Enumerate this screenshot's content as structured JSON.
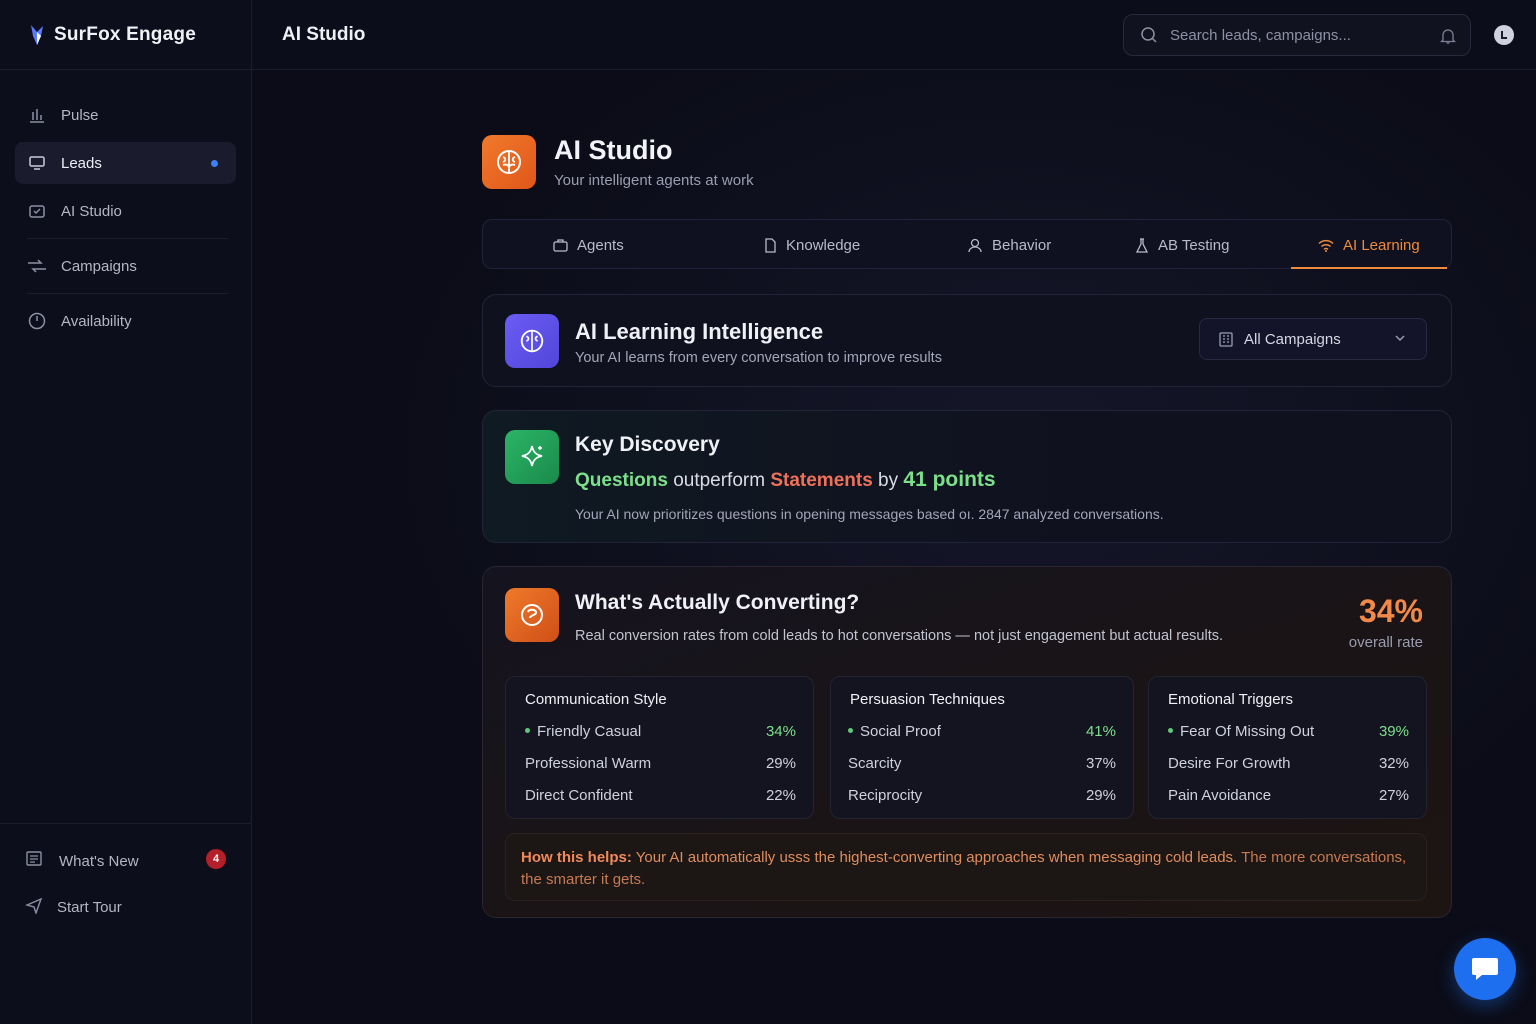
{
  "brand": {
    "name": "SurFox Engage"
  },
  "topbar": {
    "title": "AI Studio",
    "search_placeholder": "Search leads, campaigns..."
  },
  "sidebar": {
    "items": [
      {
        "label": "Pulse",
        "icon": "bar-chart-icon"
      },
      {
        "label": "Leads",
        "icon": "monitor-icon",
        "active": true
      },
      {
        "label": "AI Studio",
        "icon": "studio-icon"
      },
      {
        "label": "Campaigns",
        "icon": "campaigns-icon"
      },
      {
        "label": "Availability",
        "icon": "clock-icon"
      }
    ],
    "footer": [
      {
        "label": "What's New",
        "badge": "4"
      },
      {
        "label": "Start Tour"
      }
    ]
  },
  "page": {
    "title": "AI Studio",
    "subtitle": "Your intelligent agents at work"
  },
  "tabs": [
    {
      "label": "Agents"
    },
    {
      "label": "Knowledge"
    },
    {
      "label": "Behavior"
    },
    {
      "label": "AB Testing"
    },
    {
      "label": "AI Learning",
      "active": true
    }
  ],
  "learning": {
    "title": "AI Learning Intelligence",
    "subtitle": "Your AI learns from every conversation to improve results",
    "filter": "All Campaigns"
  },
  "discovery": {
    "title": "Key Discovery",
    "word_a": "Questions",
    "middle": "outperform",
    "word_b": "Statements",
    "by": "by",
    "points": "41 points",
    "note": "Your AI now prioritizes questions in opening messages based oı. 2847 analyzed conversations."
  },
  "converting": {
    "title": "What's Actually Converting?",
    "subtitle": "Real conversion rates from cold leads to hot conversations — not just engagement but actual results.",
    "rate": "34%",
    "rate_label": "overall rate",
    "columns": [
      {
        "title": "Communication Style",
        "rows": [
          {
            "label": "Friendly Casual",
            "pct": "34%"
          },
          {
            "label": "Professional Warm",
            "pct": "29%"
          },
          {
            "label": "Direct Confident",
            "pct": "22%"
          }
        ]
      },
      {
        "title": "Persuasion Techniques",
        "rows": [
          {
            "label": "Social Proof",
            "pct": "41%"
          },
          {
            "label": "Scarcity",
            "pct": "37%"
          },
          {
            "label": "Reciprocity",
            "pct": "29%"
          }
        ]
      },
      {
        "title": "Emotional Triggers",
        "rows": [
          {
            "label": "Fear Of Missing Out",
            "pct": "39%"
          },
          {
            "label": "Desire For Growth",
            "pct": "32%"
          },
          {
            "label": "Pain Avoidance",
            "pct": "27%"
          }
        ]
      }
    ],
    "helps_label": "How this helps:",
    "helps_text": "Your AI automatically usss the highest-converting approaches when messaging cold leads.",
    "helps_rest": "The more conversations, the smarter it gets."
  },
  "colors": {
    "accent": "#f08a3c",
    "positive": "#7ce08a",
    "negative": "#f0705a",
    "brand_blue": "#1d6ff0"
  }
}
